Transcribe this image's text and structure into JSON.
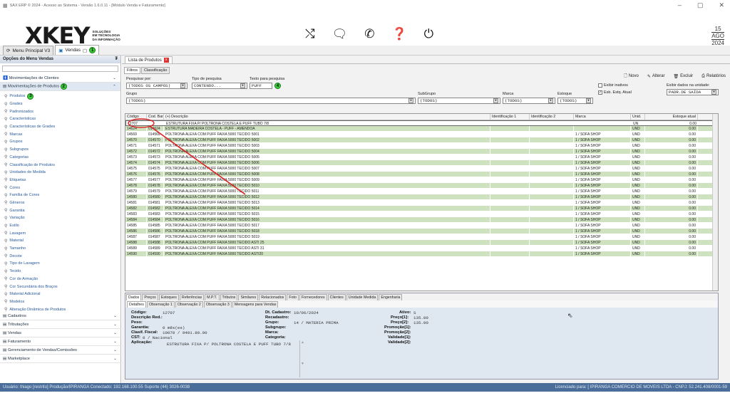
{
  "window": {
    "title": "SAX ERP © 2024 - Acesso ao Sistema - Versão 1.6.0.11 - [Módulo Venda e Faturamento]",
    "min": "–",
    "max": "▢",
    "close": "✕"
  },
  "logo": {
    "text": "XKEY",
    "line1": "SOLUÇÕES",
    "line2": "EM TECNOLOGIA",
    "line3": "DA INFORMAÇÃO"
  },
  "header_icons": [
    "shuffle-icon",
    "chat-icon",
    "whatsapp-icon",
    "help-icon",
    "power-icon"
  ],
  "date": {
    "day": "15",
    "month": "AGO",
    "year": "2024"
  },
  "top_tabs": [
    {
      "label": "Menu Principal V3"
    },
    {
      "label": "Vendas",
      "badge": "1"
    }
  ],
  "sidebar": {
    "title": "Opções do Menu Vendas",
    "pin": "₮",
    "groups_top": [
      {
        "label": "Movimentações de Clientes",
        "chev": "⌄"
      },
      {
        "label": "Movimentações de Produtos",
        "chev": "⌃",
        "badge": "2"
      }
    ],
    "items": [
      {
        "label": "Produtos",
        "badge": "3"
      },
      {
        "label": "Grades"
      },
      {
        "label": "Padronizados"
      },
      {
        "label": "Características"
      },
      {
        "label": "Características de Grades"
      },
      {
        "label": "Marcas"
      },
      {
        "label": "Grupos"
      },
      {
        "label": "Subgrupos"
      },
      {
        "label": "Categorias"
      },
      {
        "label": "Classificação de Produtos"
      },
      {
        "label": "Unidades de Medida"
      },
      {
        "label": "Etiquetas"
      },
      {
        "label": "Cores"
      },
      {
        "label": "Família de Cores"
      },
      {
        "label": "Gêneros"
      },
      {
        "label": "Garantia"
      },
      {
        "label": "Variação"
      },
      {
        "label": "Estilo"
      },
      {
        "label": "Lavagem"
      },
      {
        "label": "Material"
      },
      {
        "label": "Tamanho"
      },
      {
        "label": "Decote"
      },
      {
        "label": "Tipo de Lavagem"
      },
      {
        "label": "Tecido"
      },
      {
        "label": "Cor de Armação"
      },
      {
        "label": "Cor Secundária dos Braços"
      },
      {
        "label": "Material Adicional"
      },
      {
        "label": "Modelos"
      },
      {
        "label": "Alteração Dinâmica de Produtos"
      }
    ],
    "groups_bottom": [
      {
        "label": "Cadastros"
      },
      {
        "label": "Tributações"
      },
      {
        "label": "Vendas"
      },
      {
        "label": "Faturamento"
      },
      {
        "label": "Gerenciamento de Vendas/Comissões"
      },
      {
        "label": "Marketplace"
      }
    ]
  },
  "main_tab": {
    "label": "Lista de Produtos"
  },
  "filter_tabs": [
    "Filtros",
    "Classificação"
  ],
  "filters": {
    "pesquisar_por_label": "Pesquisar por:",
    "pesquisar_por": "(TODOS OS CAMPOS)",
    "tipo_label": "Tipo de pesquisa",
    "tipo": "CONTENDO...",
    "texto_label": "Texto para pesquisa",
    "texto": "PUFF",
    "texto_badge": "4",
    "grupo_label": "Grupo",
    "grupo": "(TODOS)",
    "subgrupo_label": "SubGrupo",
    "subgrupo": "(TODOS)",
    "marca_label": "Marca",
    "marca": "(TODOS)",
    "estoque_label": "Estoque",
    "estoque": "(TODOS)"
  },
  "toolbar": {
    "novo": "Novo",
    "alterar": "Alterar",
    "excluir": "Excluir",
    "relatorios": "Relatórios"
  },
  "options": {
    "exibir_inativos": "Exibir inativos",
    "esb_estq": "Esb. Estq. Atual",
    "unidade_label": "Exibir dados na unidade:",
    "unidade": "PADR.DE SAÍDA"
  },
  "grid": {
    "headers": [
      "Código",
      "Cod. Barra",
      "(+) Descrição",
      "Identificação 1",
      "Identificação 2",
      "Marca",
      "Unid.",
      "Estoque atual"
    ],
    "rows": [
      [
        "12707",
        "",
        "ESTRUTURA FIXA P/ POLTRONA COSTELA E PUFF TUBO 7/8",
        "",
        "",
        "",
        "UN",
        "0.00"
      ],
      [
        "14624",
        "014624",
        "ESTRUTURA MADEIRA COSTELA - PUFF - AMENDOA",
        "",
        "",
        "",
        "UND",
        "0.00"
      ],
      [
        "14569",
        "014569",
        "POLTRONA ALEXA COM PUFF FAIXA 5000 TECIDO 5001",
        "",
        "",
        "1 / SOFA SHOP",
        "UND",
        "0.00"
      ],
      [
        "14570",
        "014570",
        "POLTRONA ALEXA COM PUFF FAIXA 5000 TECIDO 5002",
        "",
        "",
        "1 / SOFA SHOP",
        "UND",
        "0.00"
      ],
      [
        "14571",
        "014571",
        "POLTRONA ALEXA COM PUFF FAIXA 5000 TECIDO 5003",
        "",
        "",
        "1 / SOFA SHOP",
        "UND",
        "0.00"
      ],
      [
        "14572",
        "014572",
        "POLTRONA ALEXA COM PUFF FAIXA 5000 TECIDO 5004",
        "",
        "",
        "1 / SOFA SHOP",
        "UND",
        "0.00"
      ],
      [
        "14573",
        "014573",
        "POLTRONA ALEXA COM PUFF FAIXA 5000 TECIDO 5005",
        "",
        "",
        "1 / SOFA SHOP",
        "UND",
        "0.00"
      ],
      [
        "14574",
        "014574",
        "POLTRONA ALEXA COM PUFF FAIXA 5000 TECIDO 5006",
        "",
        "",
        "1 / SOFA SHOP",
        "UND",
        "0.00"
      ],
      [
        "14575",
        "014575",
        "POLTRONA ALEXA COM PUFF FAIXA 5000 TECIDO 5007",
        "",
        "",
        "1 / SOFA SHOP",
        "UND",
        "0.00"
      ],
      [
        "14576",
        "014576",
        "POLTRONA ALEXA COM PUFF FAIXA 5000 TECIDO 5008",
        "",
        "",
        "1 / SOFA SHOP",
        "UND",
        "0.00"
      ],
      [
        "14577",
        "014577",
        "POLTRONA ALEXA COM PUFF FAIXA 5000 TECIDO 5009",
        "",
        "",
        "1 / SOFA SHOP",
        "UND",
        "0.00"
      ],
      [
        "14578",
        "014578",
        "POLTRONA ALEXA COM PUFF FAIXA 5000 TECIDO 5010",
        "",
        "",
        "1 / SOFA SHOP",
        "UND",
        "0.00"
      ],
      [
        "14579",
        "014579",
        "POLTRONA ALEXA COM PUFF FAIXA 5000 TECIDO 5011",
        "",
        "",
        "1 / SOFA SHOP",
        "UND",
        "0.00"
      ],
      [
        "14580",
        "014580",
        "POLTRONA ALEXA COM PUFF FAIXA 5000 TECIDO 5012",
        "",
        "",
        "1 / SOFA SHOP",
        "UND",
        "0.00"
      ],
      [
        "14581",
        "014581",
        "POLTRONA ALEXA COM PUFF FAIXA 5000 TECIDO 5013",
        "",
        "",
        "1 / SOFA SHOP",
        "UND",
        "0.00"
      ],
      [
        "14582",
        "014582",
        "POLTRONA ALEXA COM PUFF FAIXA 5000 TECIDO 5014",
        "",
        "",
        "1 / SOFA SHOP",
        "UND",
        "0.00"
      ],
      [
        "14583",
        "014583",
        "POLTRONA ALEXA COM PUFF FAIXA 5000 TECIDO 5015",
        "",
        "",
        "1 / SOFA SHOP",
        "UND",
        "0.00"
      ],
      [
        "14584",
        "014584",
        "POLTRONA ALEXA COM PUFF FAIXA 5000 TECIDO 5016",
        "",
        "",
        "1 / SOFA SHOP",
        "UND",
        "0.00"
      ],
      [
        "14585",
        "014585",
        "POLTRONA ALEXA COM PUFF FAIXA 5000 TECIDO 5017",
        "",
        "",
        "1 / SOFA SHOP",
        "UND",
        "0.00"
      ],
      [
        "14586",
        "014586",
        "POLTRONA ALEXA COM PUFF FAIXA 5000 TECIDO 5018",
        "",
        "",
        "1 / SOFA SHOP",
        "UND",
        "0.00"
      ],
      [
        "14587",
        "014587",
        "POLTRONA ALEXA COM PUFF FAIXA 5000 TECIDO 5019",
        "",
        "",
        "1 / SOFA SHOP",
        "UND",
        "0.00"
      ],
      [
        "14588",
        "014588",
        "POLTRONA ALEXA COM PUFF FAIXA 5000 TECIDO ASTI 25",
        "",
        "",
        "1 / SOFA SHOP",
        "UND",
        "0.00"
      ],
      [
        "14589",
        "014589",
        "POLTRONA ALEXA COM PUFF FAIXA 5000 TECIDO ASTI 31",
        "",
        "",
        "1 / SOFA SHOP",
        "UND",
        "0.00"
      ],
      [
        "14590",
        "014590",
        "POLTRONA ALEXA COM PUFF FAIXA 5000 TECIDO ASTI20",
        "",
        "",
        "1 / SOFA SHOP",
        "UND",
        "0.00"
      ]
    ]
  },
  "detail_tabs": [
    "Dados",
    "Preços",
    "Estoques",
    "Referências",
    "M.P.T.",
    "Tributos",
    "Similares",
    "Relacionados",
    "Foto",
    "Fornecedores",
    "Clientes",
    "Unidade Medida",
    "Engenharia"
  ],
  "detail_subtabs": [
    "Detalhes",
    "Observação 1",
    "Observação 2",
    "Observação 3",
    "Mensagens para Vendas"
  ],
  "detail": {
    "codigo_l": "Código:",
    "codigo": "12707",
    "descred_l": "Descrição Red.:",
    "descred": "",
    "peso_l": "Peso:",
    "peso": "",
    "garantia_l": "Garantia:",
    "garantia": "0 mês(es)",
    "ncm_l": "Clasif. Fiscal:",
    "ncm": "10070 / 9401.80.00",
    "cst_l": "CST:",
    "cst": "0 / Nacional",
    "aplicacao_l": "Aplicação:",
    "aplicacao": "ESTRUTURA FIXA P/ POLTRONA COSTELA E PUFF TUBO 7/8",
    "dtcad_l": "Dt. Cadastro:",
    "dtcad": "10/06/2024",
    "recad_l": "Recadastro:",
    "recad": "",
    "grupo_l": "Grupo:",
    "grupo": "14 / MATERIA PRIMA",
    "subgrupo_l": "Subgrupo:",
    "subgrupo": "",
    "marca_l": "Marca:",
    "marca": "",
    "categoria_l": "Categoria:",
    "categoria": "",
    "ativo_l": "Ativo:",
    "ativo": "S",
    "preco1_l": "Preço[1]:",
    "preco1": "135.00",
    "preco2_l": "Preço[2]:",
    "preco2": "135.00",
    "promo1_l": "Promoção[1]:",
    "promo2_l": "Promoção[2]:",
    "val1_l": "Validade[1]:",
    "val2_l": "Validade[2]:"
  },
  "status": {
    "left": "Usuário: thiago [restrito]   Produção/IPIRANGA   Conectado: 192.168.100.55   Suporte (44) 3026-0038",
    "right": "Licenciado para: [ IPIRANGA COMERCIO DE MOVEIS LTDA - CNPJ: 52.241.408/0001-59"
  }
}
